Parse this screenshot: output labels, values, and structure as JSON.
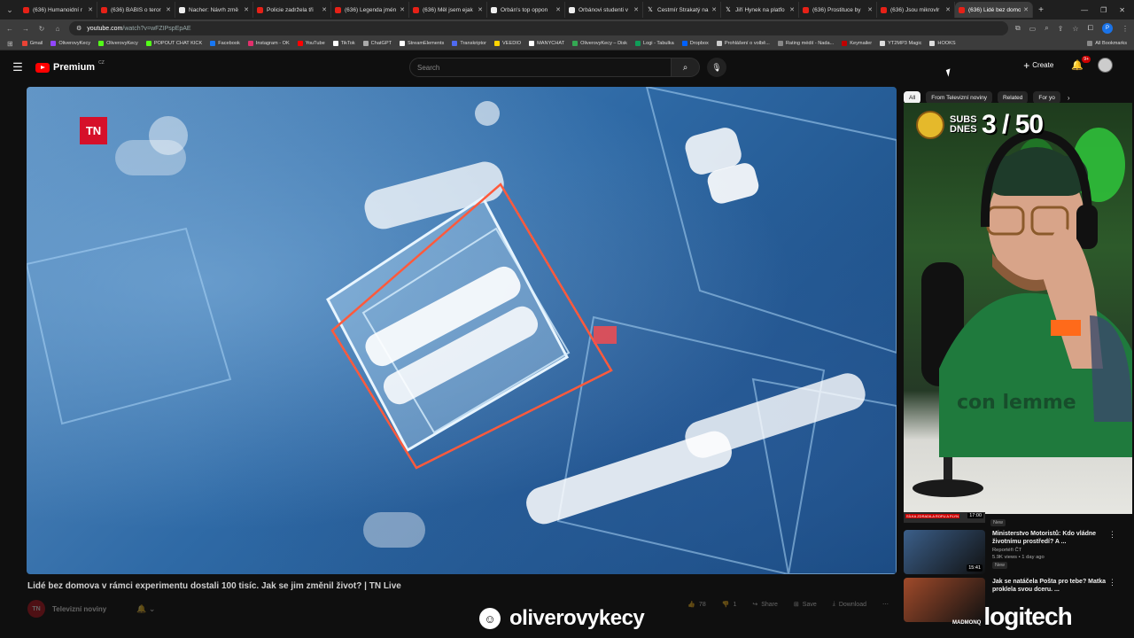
{
  "browser": {
    "tabs": [
      {
        "title": "(636) Humanoidní r",
        "icon": "youtube-icon"
      },
      {
        "title": "(636) BABIŠ o teror",
        "icon": "youtube-icon"
      },
      {
        "title": "Nacher: Návrh změ",
        "icon": "news-icon"
      },
      {
        "title": "Policie zadržela tři",
        "icon": "youtube-icon"
      },
      {
        "title": "(636) Legenda jmén",
        "icon": "youtube-icon"
      },
      {
        "title": "(636) Měl jsem ejak",
        "icon": "youtube-icon"
      },
      {
        "title": "Orbán's top oppon",
        "icon": "news-icon"
      },
      {
        "title": "Orbánovi studenti v",
        "icon": "news-icon"
      },
      {
        "title": "Čestmír Strakatý na",
        "icon": "x-icon"
      },
      {
        "title": "Jiří Hynek na platfo",
        "icon": "x-icon"
      },
      {
        "title": "(636) Prostituce by",
        "icon": "youtube-icon"
      },
      {
        "title": "(636) Jsou mikrovlr",
        "icon": "youtube-icon"
      },
      {
        "title": "(636) Lidé bez domo",
        "icon": "youtube-icon",
        "active": true
      }
    ],
    "url_host": "youtube.com",
    "url_path": "/watch?v=wFZIPspEpAE",
    "profile_initial": "P",
    "bookmarks": [
      {
        "label": "Gmail",
        "color": "#ea4335"
      },
      {
        "label": "OliverovyKecy",
        "color": "#9146ff"
      },
      {
        "label": "OliverovyKecy",
        "color": "#53fc18"
      },
      {
        "label": "POPOUT CHAT KICK",
        "color": "#53fc18"
      },
      {
        "label": "Facebook",
        "color": "#1877f2"
      },
      {
        "label": "Instagram - OK",
        "color": "#e1306c"
      },
      {
        "label": "YouTube",
        "color": "#ff0000"
      },
      {
        "label": "TikTok",
        "color": "#ffffff"
      },
      {
        "label": "ChatGPT",
        "color": "#aaaaaa"
      },
      {
        "label": "StreamElements",
        "color": "#ffffff"
      },
      {
        "label": "Transkriptor",
        "color": "#4f6af0"
      },
      {
        "label": "VEEDIO",
        "color": "#ffd400"
      },
      {
        "label": "MANYCHAT",
        "color": "#ffffff"
      },
      {
        "label": "OliverovyKecy – Disk",
        "color": "#34a853"
      },
      {
        "label": "Logi - Tabulka",
        "color": "#0f9d58"
      },
      {
        "label": "Dropbox",
        "color": "#0061ff"
      },
      {
        "label": "Prohlášení o volbě...",
        "color": "#cccccc"
      },
      {
        "label": "Rating médií - Nada...",
        "color": "#888888"
      },
      {
        "label": "Keymailer",
        "color": "#c00000"
      },
      {
        "label": "YT2MP3 Magic",
        "color": "#dddddd"
      },
      {
        "label": "HOOKS",
        "color": "#dddddd"
      }
    ],
    "all_bookmarks_label": "All Bookmarks"
  },
  "youtube": {
    "brand": "Premium",
    "country": "CZ",
    "search_placeholder": "Search",
    "create_label": "Create",
    "notification_count": "9+"
  },
  "player": {
    "logo_text": "TN"
  },
  "video": {
    "title": "Lidé bez domova v rámci experimentu dostali 100 tisíc. Jak se jim změnil život? | TN Live",
    "channel_name": "Televizní noviny",
    "channel_avatar_text": "TN",
    "likes": "78",
    "dislikes": "1",
    "share_label": "Share",
    "save_label": "Save",
    "download_label": "Download"
  },
  "sidebar": {
    "chips": [
      {
        "label": "All",
        "active": true
      },
      {
        "label": "From Televizní noviny"
      },
      {
        "label": "Related"
      },
      {
        "label": "For yo"
      }
    ],
    "subs_label": "SUBS DNES",
    "subs_count": "3 / 50",
    "recommendations": [
      {
        "title": "Ministerstvo Motoristů: Kdo vládne životnímu prostředí? A ...",
        "channel": "Reportéři ČT",
        "meta": "5.9K views • 1 day ago",
        "badge": "New",
        "duration": "15:41",
        "thumb_color": "#3b5f8a"
      },
      {
        "title": "Jak se natáčela Pošta pro tebe? Matka proklela svou dceru. ...",
        "channel": "",
        "meta": "",
        "badge": "",
        "duration": "",
        "thumb_color": "#a04a2a"
      }
    ],
    "partial_item": {
      "badge": "New",
      "duration": "17:00",
      "caption": "SÍLKA ZDRADILA ROPU A PLYN"
    }
  },
  "overlay": {
    "handle": "oliverovykecy",
    "sponsor_small": "MADMONQ",
    "sponsor": "logitech"
  }
}
